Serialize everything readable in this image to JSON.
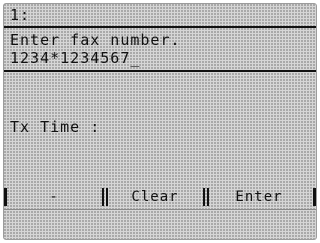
{
  "screen": {
    "header_index": "1:",
    "prompt": "Enter fax number.",
    "fax_number_value": "1234*1234567",
    "cursor": "_",
    "tx_time_label": "Tx Time :"
  },
  "softkeys": {
    "left_label": "-",
    "middle_label": "Clear",
    "right_label": "Enter"
  }
}
